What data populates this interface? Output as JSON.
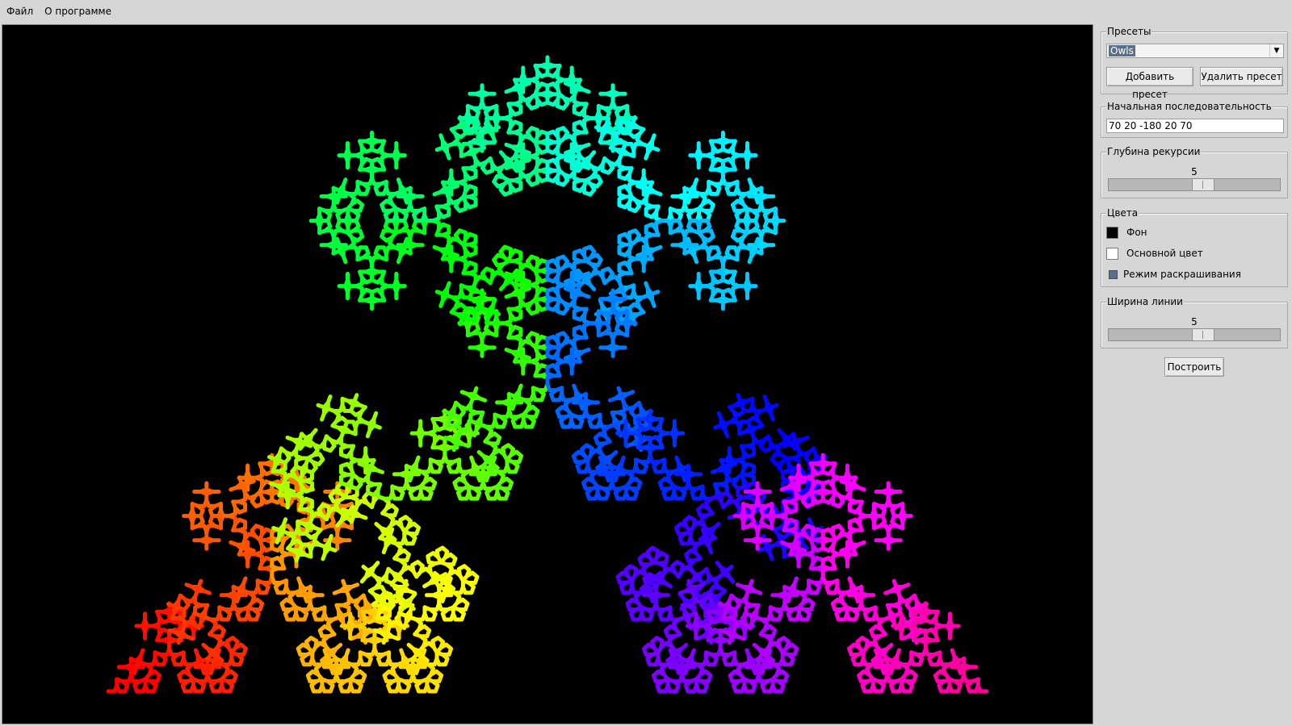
{
  "menu": {
    "file": "Файл",
    "about": "О программе"
  },
  "presets": {
    "legend": "Пресеты",
    "selected": "Owls",
    "add_label": "Добавить пресет",
    "remove_label": "Удалить пресет"
  },
  "sequence": {
    "legend": "Начальная последовательность",
    "value": "70 20 -180 20 70"
  },
  "depth": {
    "legend": "Глубина рекурсии",
    "value": "5",
    "fraction": 0.55
  },
  "colors": {
    "legend": "Цвета",
    "background_label": "Фон",
    "background_color": "#000000",
    "main_label": "Основной цвет",
    "main_color": "#ffffff",
    "coloring_label": "Режим раскрашивания",
    "coloring_on": true
  },
  "line_width": {
    "legend": "Ширина линии",
    "value": "5",
    "fraction": 0.55
  },
  "build_label": "Построить",
  "fractal": {
    "sequence": [
      70,
      20,
      -180,
      20,
      70
    ],
    "depth": 5,
    "line_width": 5,
    "background": "#000000",
    "coloring": "rainbow"
  }
}
